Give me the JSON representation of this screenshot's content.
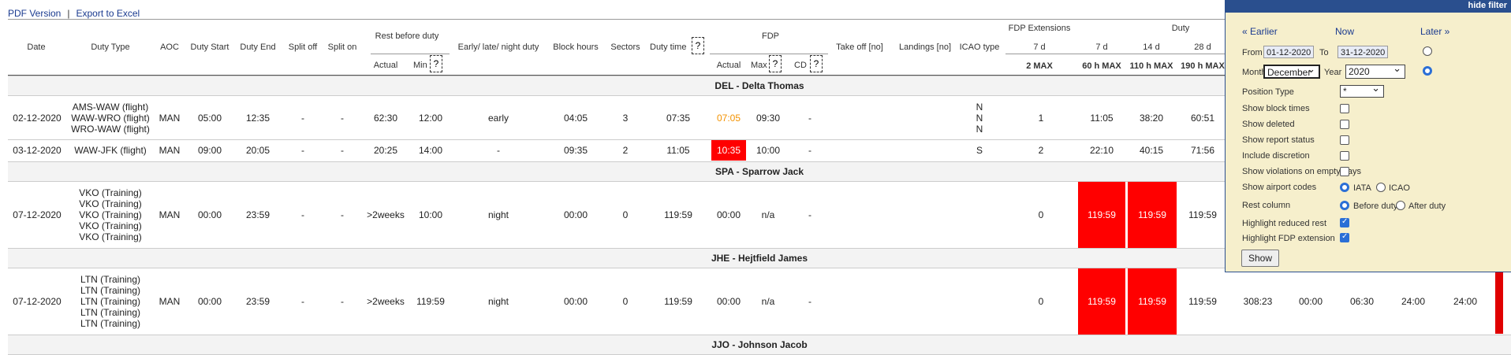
{
  "links": {
    "pdf": "PDF Version",
    "sep": "|",
    "excel": "Export to Excel"
  },
  "headers": {
    "date": "Date",
    "duty_type": "Duty Type",
    "aoc": "AOC",
    "duty_start": "Duty Start",
    "duty_end": "Duty End",
    "split_off": "Split off",
    "split_on": "Split on",
    "rest_before": "Rest before duty",
    "actual": "Actual",
    "min": "Min",
    "eln": "Early/ late/ night duty",
    "block": "Block hours",
    "sectors": "Sectors",
    "duty_time": "Duty time",
    "fdp": "FDP",
    "fdp_actual": "Actual",
    "fdp_max": "Max",
    "cd": "CD",
    "takeoff": "Take off [no]",
    "landings": "Landings [no]",
    "icao_type": "ICAO type",
    "fdp_ext": "FDP Extensions",
    "ext_7d": "7 d",
    "ext_2max": "2 MAX",
    "duty": "Duty",
    "d7": "7 d",
    "d7sub": "60 h MAX",
    "d14": "14 d",
    "d14sub": "110 h MAX",
    "d28": "28 d",
    "d28sub": "190 h MAX",
    "q": "?"
  },
  "groups": [
    {
      "name": "DEL - Delta Thomas",
      "rows": [
        {
          "date": "02-12-2020",
          "duty": [
            "AMS-WAW (flight)",
            "WAW-WRO (flight)",
            "WRO-WAW (flight)"
          ],
          "aoc": "MAN",
          "start": "05:00",
          "end": "12:35",
          "soff": "-",
          "son": "-",
          "ractual": "62:30",
          "rmin": "12:00",
          "eln": "early",
          "block": "04:05",
          "sectors": "3",
          "dtime": "07:35",
          "factual": "07:05",
          "fmax": "09:30",
          "cd": "-",
          "icao": [
            "N",
            "N",
            "N"
          ],
          "ext": "1",
          "d7": "11:05",
          "d14": "38:20",
          "d28": "60:51"
        },
        {
          "date": "03-12-2020",
          "duty": [
            "WAW-JFK (flight)"
          ],
          "aoc": "MAN",
          "start": "09:00",
          "end": "20:05",
          "soff": "-",
          "son": "-",
          "ractual": "20:25",
          "rmin": "14:00",
          "eln": "-",
          "block": "09:35",
          "sectors": "2",
          "dtime": "11:05",
          "factual": "10:35",
          "fmax": "10:00",
          "cd": "-",
          "icao": [
            "S"
          ],
          "ext": "2",
          "d7": "22:10",
          "d14": "40:15",
          "d28": "71:56"
        }
      ]
    },
    {
      "name": "SPA - Sparrow Jack",
      "rows": [
        {
          "date": "07-12-2020",
          "duty": [
            "VKO (Training)",
            "VKO (Training)",
            "VKO (Training)",
            "VKO (Training)",
            "VKO (Training)"
          ],
          "aoc": "MAN",
          "start": "00:00",
          "end": "23:59",
          "soff": "-",
          "son": "-",
          "ractual": ">2weeks",
          "rmin": "10:00",
          "eln": "night",
          "block": "00:00",
          "sectors": "0",
          "dtime": "119:59",
          "factual": "00:00",
          "fmax": "n/a",
          "cd": "-",
          "icao": [],
          "ext": "0",
          "d7": "119:59",
          "d14": "119:59",
          "d28": "119:59"
        }
      ]
    },
    {
      "name": "JHE - Hejtfield James",
      "rows": [
        {
          "date": "07-12-2020",
          "duty": [
            "LTN (Training)",
            "LTN (Training)",
            "LTN (Training)",
            "LTN (Training)",
            "LTN (Training)"
          ],
          "aoc": "MAN",
          "start": "00:00",
          "end": "23:59",
          "soff": "-",
          "son": "-",
          "ractual": ">2weeks",
          "rmin": "119:59",
          "eln": "night",
          "block": "00:00",
          "sectors": "0",
          "dtime": "119:59",
          "factual": "00:00",
          "fmax": "n/a",
          "cd": "-",
          "icao": [],
          "ext": "0",
          "d7": "119:59",
          "d14": "119:59",
          "d28": "119:59",
          "extra": [
            "308:23",
            "00:00",
            "06:30",
            "24:00",
            "24:00"
          ]
        }
      ]
    },
    {
      "name": "JJO - Johnson Jacob",
      "rows": []
    }
  ],
  "filter": {
    "hide": "hide filter",
    "earlier": "« Earlier",
    "now": "Now",
    "later": "Later »",
    "from_label": "From",
    "from": "01-12-2020",
    "to_label": "To",
    "to": "31-12-2020",
    "month_label": "Month",
    "month": "December",
    "year_label": "Year",
    "year": "2020",
    "position_label": "Position Type",
    "position": "*",
    "options": [
      {
        "label": "Show block times",
        "checked": false
      },
      {
        "label": "Show deleted",
        "checked": false
      },
      {
        "label": "Show report status",
        "checked": false
      },
      {
        "label": "Include discretion",
        "checked": false
      },
      {
        "label": "Show violations on empty days",
        "checked": false
      }
    ],
    "airport_label": "Show airport codes",
    "iata": "IATA",
    "icao": "ICAO",
    "rest_label": "Rest column",
    "before": "Before duty",
    "after": "After duty",
    "reduced_label": "Highlight reduced rest",
    "fdpext_label": "Highlight FDP extension",
    "show_btn": "Show"
  }
}
